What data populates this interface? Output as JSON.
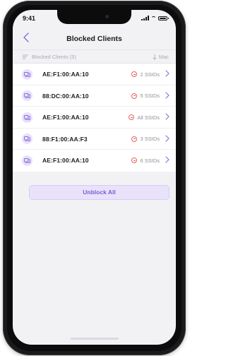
{
  "status_bar": {
    "time": "9:41"
  },
  "nav": {
    "title": "Blocked Clients"
  },
  "list_header": {
    "label": "Blocked Clients (5)",
    "sort_label": "Mac"
  },
  "clients": [
    {
      "mac": "AE:F1:00:AA:10",
      "ssids": "2 SSIDs"
    },
    {
      "mac": "88:DC:00:AA:10",
      "ssids": "5 SSIDs"
    },
    {
      "mac": "AE:F1:00:AA:10",
      "ssids": "All SSIDs"
    },
    {
      "mac": "88:F1:00:AA:F3",
      "ssids": "3 SSIDs"
    },
    {
      "mac": "AE:F1:00:AA:10",
      "ssids": "6 SSIDs"
    }
  ],
  "actions": {
    "unblock_all_label": "Unblock All"
  },
  "colors": {
    "accent": "#8b6cd9",
    "blocked": "#e2635e",
    "background": "#f2f2f5"
  },
  "icons": {
    "back": "chevron-left-icon",
    "filter": "list-filter-icon",
    "sort": "arrow-down-icon",
    "device": "devices-icon",
    "blocked": "minus-circle-icon",
    "row_chevron": "chevron-right-icon"
  }
}
